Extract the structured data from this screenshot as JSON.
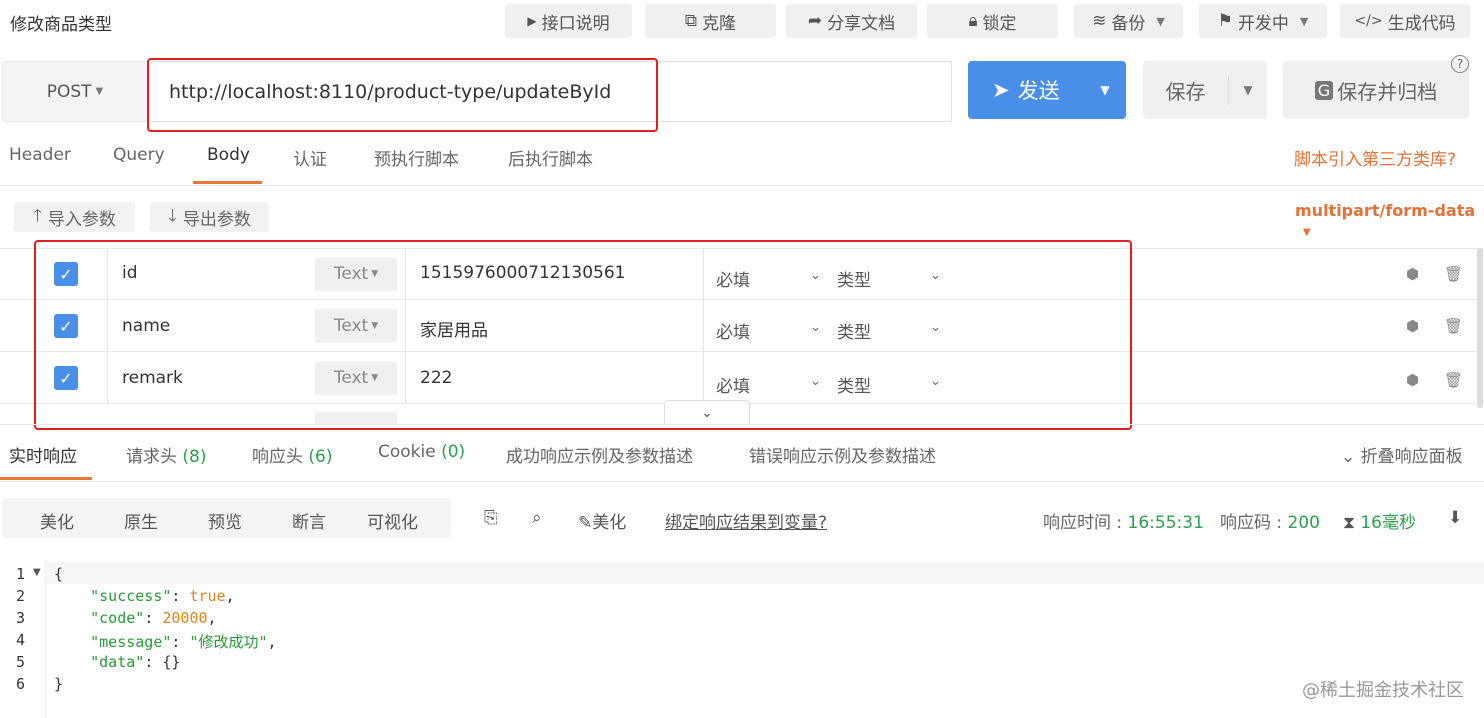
{
  "header": {
    "title": "修改商品类型",
    "buttons": {
      "api_doc": "接口说明",
      "clone": "克隆",
      "share": "分享文档",
      "lock": "锁定",
      "backup": "备份",
      "dev": "开发中",
      "gencode": "生成代码"
    }
  },
  "request": {
    "method": "POST",
    "url": "http://localhost:8110/product-type/updateById",
    "send_label": "发送",
    "save_label": "保存",
    "save_archive_label": "保存并归档",
    "help": "?"
  },
  "tabs": {
    "items": [
      "Header",
      "Query",
      "Body",
      "认证",
      "预执行脚本",
      "后执行脚本"
    ],
    "active": "Body",
    "third_party_link": "脚本引入第三方类库?"
  },
  "body": {
    "import_label": "导入参数",
    "export_label": "导出参数",
    "content_type": "multipart/form-data",
    "params": [
      {
        "checked": true,
        "name": "id",
        "type": "Text",
        "value": "1515976000712130561",
        "required": "必填",
        "kind": "类型"
      },
      {
        "checked": true,
        "name": "name",
        "type": "Text",
        "value": "家居用品",
        "required": "必填",
        "kind": "类型"
      },
      {
        "checked": true,
        "name": "remark",
        "type": "Text",
        "value": "222",
        "required": "必填",
        "kind": "类型"
      }
    ]
  },
  "response": {
    "tabs": [
      "实时响应",
      "请求头",
      "响应头",
      "Cookie",
      "成功响应示例及参数描述",
      "错误响应示例及参数描述"
    ],
    "tab_counts": {
      "req_headers": "(8)",
      "resp_headers": "(6)",
      "cookie": "(0)"
    },
    "collapse_label": "折叠响应面板",
    "views": [
      "美化",
      "原生",
      "预览",
      "断言",
      "可视化"
    ],
    "beautify_label": "美化",
    "bind_link": "绑定响应结果到变量?",
    "time_label": "响应时间 :",
    "time_value": "16:55:31",
    "code_label": "响应码 :",
    "code_value": "200",
    "duration": "16毫秒",
    "body": {
      "success": "true",
      "code": "20000",
      "message": "\"修改成功\"",
      "data": "{}"
    },
    "line_numbers": [
      "1",
      "2",
      "3",
      "4",
      "5",
      "6"
    ]
  },
  "watermark": "@稀土掘金技术社区",
  "colors": {
    "accent_blue": "#4a8fe7",
    "accent_orange": "#e8773a",
    "highlight_red": "#e02020",
    "success_green": "#2e9e4e"
  }
}
